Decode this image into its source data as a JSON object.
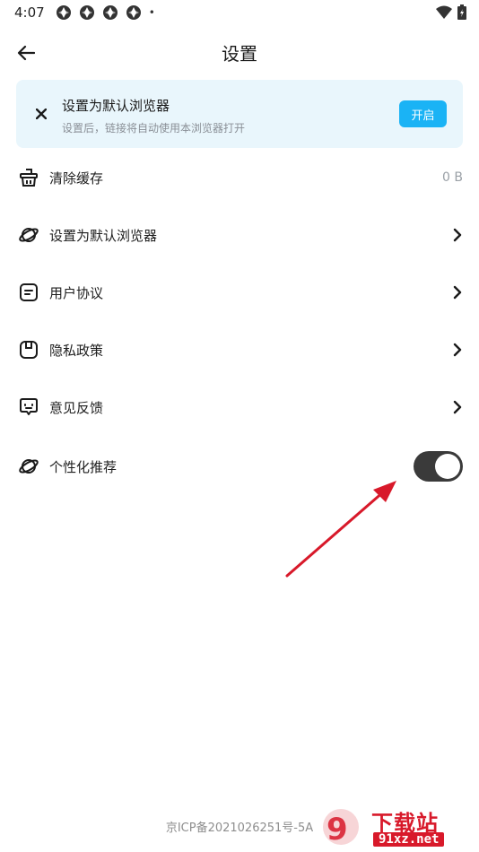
{
  "status_bar": {
    "time": "4:07",
    "notification_icons": [
      "app-icon",
      "app-icon",
      "app-icon",
      "app-icon"
    ],
    "dot": "•",
    "right_icons": [
      "wifi-icon",
      "battery-icon"
    ]
  },
  "header": {
    "title": "设置",
    "back_icon": "back-arrow-icon"
  },
  "banner": {
    "title": "设置为默认浏览器",
    "subtitle": "设置后，链接将自动使用本浏览器打开",
    "button_label": "开启",
    "close_icon": "close-icon",
    "button_color": "#1ab3f5",
    "background_color": "#e9f6fc"
  },
  "settings": {
    "items": [
      {
        "label": "清除缓存",
        "icon": "basket-icon",
        "value": "0 B"
      },
      {
        "label": "设置为默认浏览器",
        "icon": "planet-icon",
        "chevron": true
      },
      {
        "label": "用户协议",
        "icon": "document-icon",
        "chevron": true
      },
      {
        "label": "隐私政策",
        "icon": "shield-icon",
        "chevron": true
      },
      {
        "label": "意见反馈",
        "icon": "feedback-icon",
        "chevron": true
      },
      {
        "label": "个性化推荐",
        "icon": "planet-icon",
        "toggle": true,
        "toggle_on": true
      }
    ]
  },
  "footer": {
    "icp": "京ICP备2021026251号-5A"
  },
  "watermark": {
    "name": "下载站",
    "domain": "91xz.net"
  },
  "colors": {
    "annotation_arrow": "#d8192a",
    "toggle_track": "#3a3a3a"
  }
}
